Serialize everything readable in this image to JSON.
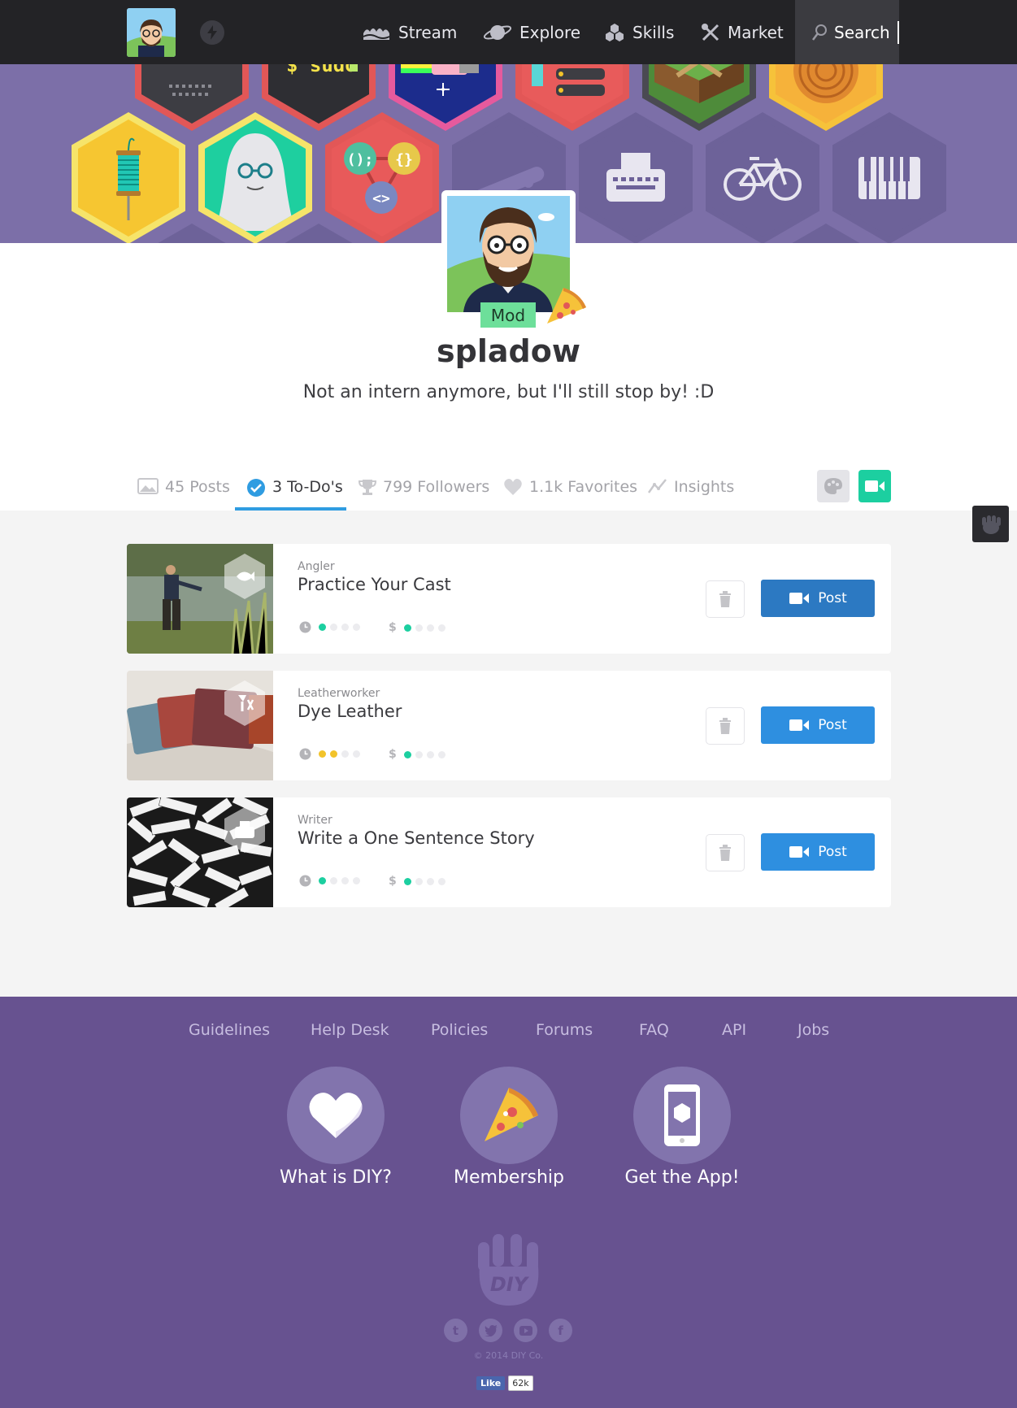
{
  "nav": {
    "items": [
      {
        "label": "Stream",
        "icon": "stream-icon"
      },
      {
        "label": "Explore",
        "icon": "planet-icon"
      },
      {
        "label": "Skills",
        "icon": "skills-icon"
      },
      {
        "label": "Market",
        "icon": "tools-icon"
      }
    ],
    "search_label": "Search"
  },
  "profile": {
    "username": "spladow",
    "badge": "Mod",
    "bio": "Not an intern anymore, but I'll still stop by!  :D"
  },
  "tabs": [
    {
      "label": "45 Posts",
      "icon": "image-icon"
    },
    {
      "label": "3 To-Do's",
      "icon": "check-circle-icon",
      "active": true
    },
    {
      "label": "799 Followers",
      "icon": "trophy-icon"
    },
    {
      "label": "1.1k Favorites",
      "icon": "heart-icon"
    },
    {
      "label": "Insights",
      "icon": "chart-line-icon"
    }
  ],
  "todos": [
    {
      "skill": "Angler",
      "title": "Practice Your Cast",
      "time_level": 1,
      "cost_level": 1,
      "time_color": "#1ccfa0",
      "button": "Post",
      "button_color": "#2c79c2"
    },
    {
      "skill": "Leatherworker",
      "title": "Dye Leather",
      "time_level": 2,
      "cost_level": 1,
      "time_color": "#f2c32a",
      "button": "Post",
      "button_color": "#2e8fe0"
    },
    {
      "skill": "Writer",
      "title": "Write a One Sentence Story",
      "time_level": 1,
      "cost_level": 1,
      "time_color": "#1ccfa0",
      "button": "Post",
      "button_color": "#2e8fe0"
    }
  ],
  "meter_icons": {
    "time": "clock-icon",
    "cost": "$"
  },
  "footer": {
    "links": [
      "Guidelines",
      "Help Desk",
      "Policies",
      "Forums",
      "FAQ",
      "API",
      "Jobs"
    ],
    "features": [
      {
        "label": "What is DIY?",
        "icon": "heart-icon"
      },
      {
        "label": "Membership",
        "icon": "pizza-icon"
      },
      {
        "label": "Get the App!",
        "icon": "phone-icon"
      }
    ],
    "logo_text": "DIY",
    "social": [
      "t",
      "twitter-icon",
      "youtube-icon",
      "f"
    ],
    "copyright": "© 2014 DIY Co.",
    "fb_like": "Like",
    "fb_count": "62k"
  },
  "colors": {
    "nav_bg": "#232326",
    "banner_bg": "#7c6fa8",
    "accent_blue": "#2f9ce1",
    "accent_green": "#1ccfa0",
    "footer_bg": "#675290"
  }
}
